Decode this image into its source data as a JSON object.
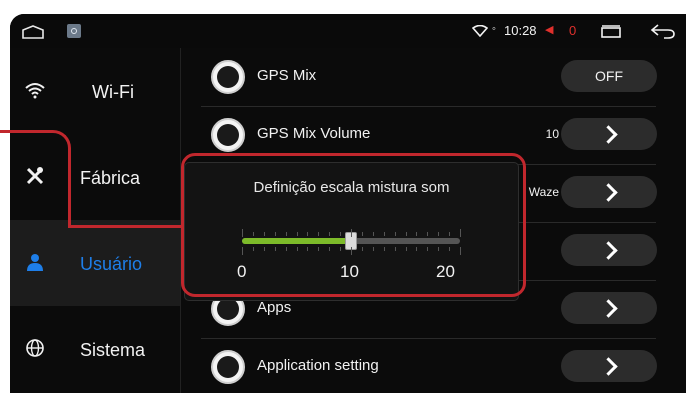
{
  "statusbar": {
    "time": "10:28",
    "volume": "0",
    "icons": [
      "home-icon",
      "app-icon",
      "wifi-icon",
      "location-icon",
      "volume-icon",
      "recents-icon",
      "back-icon"
    ]
  },
  "sidebar": {
    "items": [
      {
        "label": "Wi-Fi",
        "icon": "wifi-icon",
        "active": false
      },
      {
        "label": "Fábrica",
        "icon": "tools-icon",
        "active": false
      },
      {
        "label": "Usuário",
        "icon": "user-icon",
        "active": true
      },
      {
        "label": "Sistema",
        "icon": "globe-icon",
        "active": false
      }
    ]
  },
  "list": {
    "rows": [
      {
        "label": "GPS Mix",
        "icon": "satellite-icon",
        "value": "",
        "control": "OFF"
      },
      {
        "label": "GPS Mix Volume",
        "icon": "volume-bars-icon",
        "value": "10",
        "control": "chevron"
      },
      {
        "label": "",
        "icon": "check-icon",
        "value": "Waze",
        "control": "chevron"
      },
      {
        "label": "",
        "icon": "android-icon",
        "value": "",
        "control": "chevron"
      },
      {
        "label": "Apps",
        "icon": "android-icon",
        "value": "",
        "control": "chevron"
      },
      {
        "label": "Application setting",
        "icon": "android-icon",
        "value": "",
        "control": "chevron"
      }
    ]
  },
  "popup": {
    "title": "Definição escala mistura som",
    "slider": {
      "min": 0,
      "max": 20,
      "value": 10
    },
    "scale_labels": [
      "0",
      "10",
      "20"
    ]
  },
  "colors": {
    "accent": "#1e7ee8",
    "slider_fill": "#7dbb2a",
    "callout": "#c1272d",
    "volume_muted": "#e0302c"
  }
}
